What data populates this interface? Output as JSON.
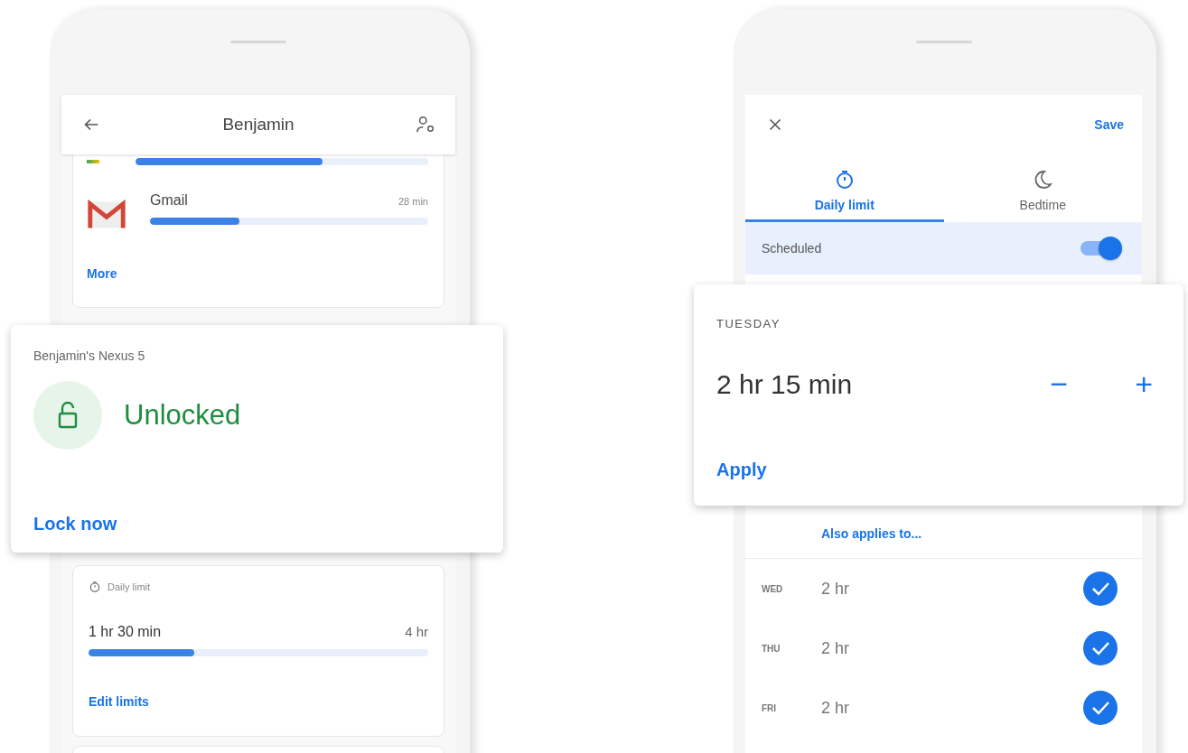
{
  "left_phone": {
    "title": "Benjamin",
    "top_bar": {
      "level": 0.64
    },
    "apps": [
      {
        "name": "Gmail",
        "time": "28 min",
        "level": 0.32
      }
    ],
    "more_link": "More",
    "device_card": {
      "device": "Benjamin's Nexus 5",
      "status": "Unlocked",
      "locked": false,
      "action": "Lock now"
    },
    "daily_limit": {
      "label": "Daily limit",
      "used": "1 hr 30 min",
      "limit": "4 hr",
      "level": 0.31,
      "action": "Edit limits"
    }
  },
  "right_phone": {
    "save": "Save",
    "tabs": [
      {
        "label": "Daily limit",
        "kind": "timer",
        "selected": true
      },
      {
        "label": "Bedtime",
        "kind": "moon",
        "selected": false
      }
    ],
    "scheduled": {
      "label": "Scheduled",
      "on": true
    },
    "day_card": {
      "day": "TUESDAY",
      "value": "2 hr 15 min",
      "minus": "−",
      "plus": "+",
      "action": "Apply"
    },
    "also_applies": "Also applies to...",
    "days": [
      {
        "day": "WED",
        "value": "2 hr",
        "checked": true
      },
      {
        "day": "THU",
        "value": "2 hr",
        "checked": true
      },
      {
        "day": "FRI",
        "value": "2 hr",
        "checked": true
      }
    ]
  }
}
